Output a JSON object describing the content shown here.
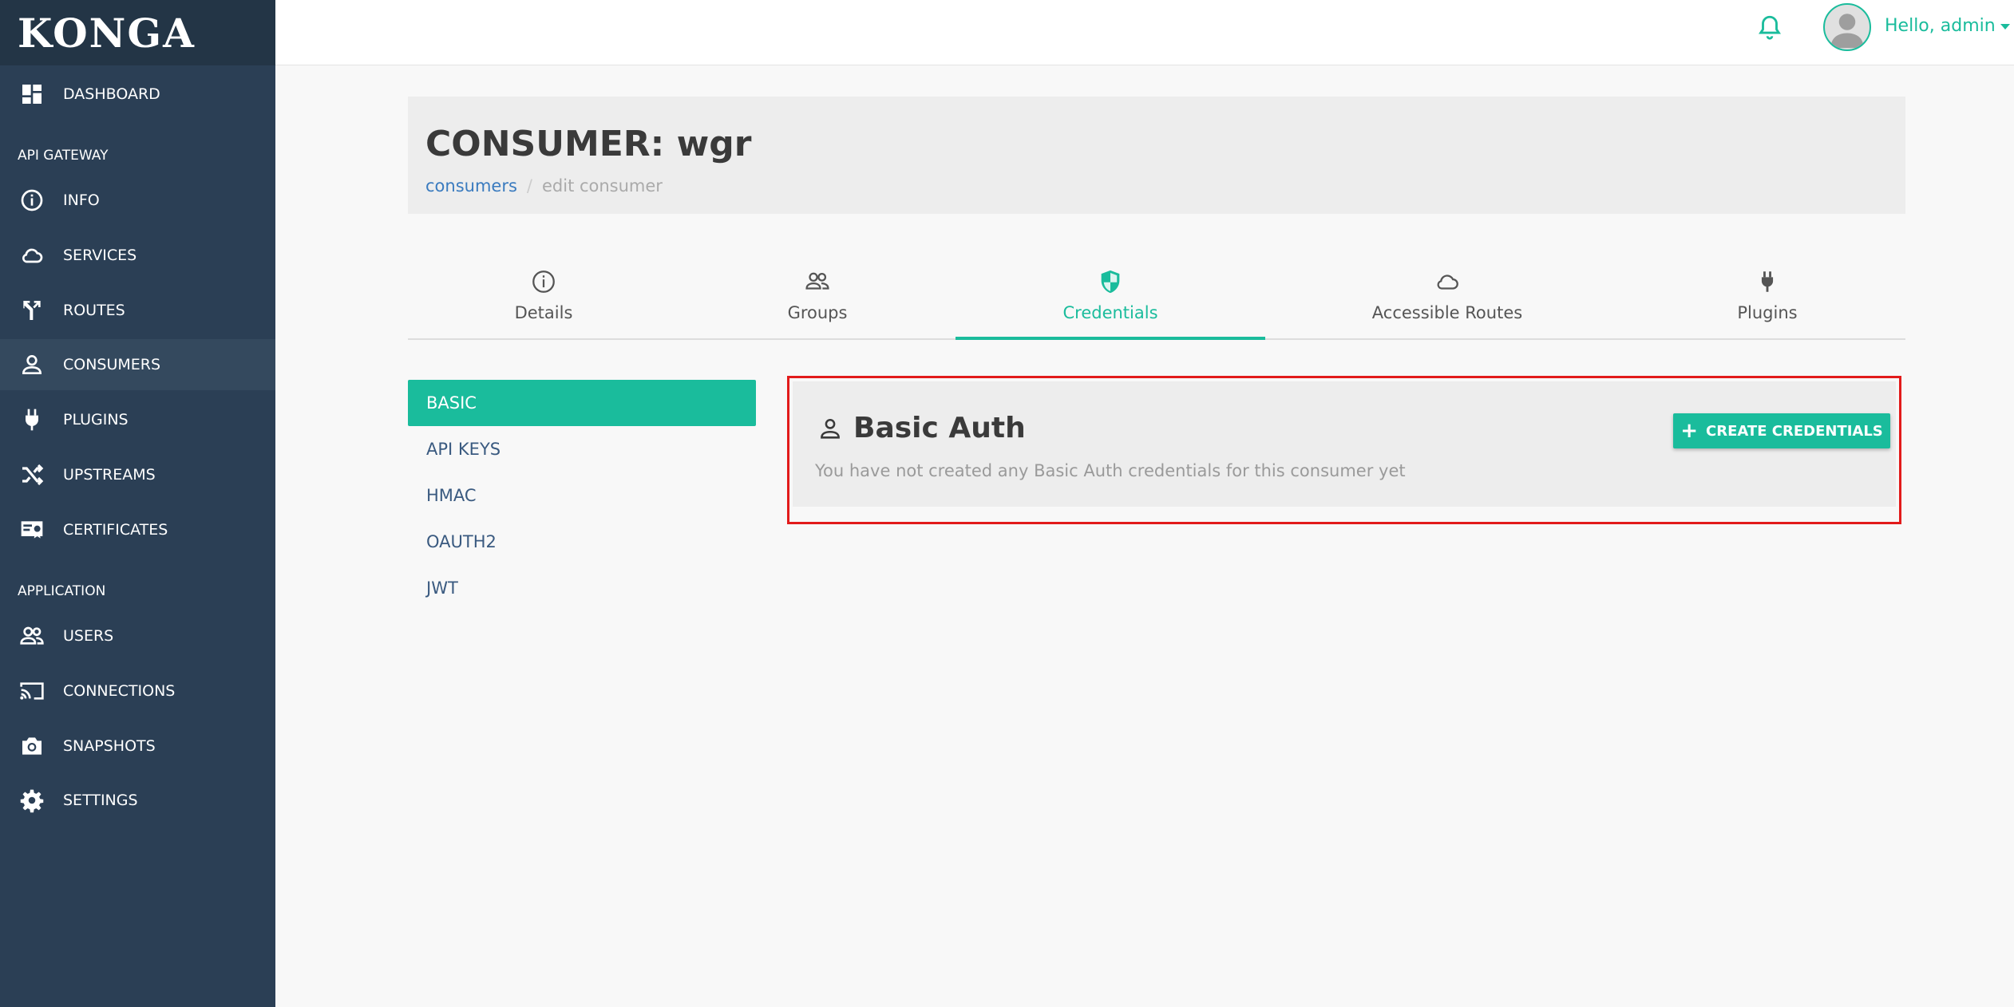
{
  "brand": {
    "name": "KONGA"
  },
  "sidebar": {
    "items": [
      {
        "label": "DASHBOARD",
        "icon": "dashboard-icon"
      },
      {
        "label": "INFO",
        "icon": "info-icon"
      },
      {
        "label": "SERVICES",
        "icon": "cloud-icon"
      },
      {
        "label": "ROUTES",
        "icon": "routes-icon"
      },
      {
        "label": "CONSUMERS",
        "icon": "person-icon",
        "active": true
      },
      {
        "label": "PLUGINS",
        "icon": "plug-icon"
      },
      {
        "label": "UPSTREAMS",
        "icon": "shuffle-icon"
      },
      {
        "label": "CERTIFICATES",
        "icon": "certificate-icon"
      },
      {
        "label": "USERS",
        "icon": "users-icon"
      },
      {
        "label": "CONNECTIONS",
        "icon": "cast-icon"
      },
      {
        "label": "SNAPSHOTS",
        "icon": "camera-icon"
      },
      {
        "label": "SETTINGS",
        "icon": "gear-icon"
      }
    ],
    "sections": {
      "api_gateway": "API GATEWAY",
      "application": "APPLICATION"
    }
  },
  "topbar": {
    "greeting": "Hello, admin"
  },
  "page": {
    "title": "CONSUMER: wgr",
    "breadcrumb": {
      "link": "consumers",
      "separator": "/",
      "current": "edit consumer"
    }
  },
  "tabs": [
    {
      "label": "Details",
      "icon": "info-icon"
    },
    {
      "label": "Groups",
      "icon": "users-icon"
    },
    {
      "label": "Credentials",
      "icon": "shield-icon",
      "active": true
    },
    {
      "label": "Accessible Routes",
      "icon": "cloud-icon"
    },
    {
      "label": "Plugins",
      "icon": "plug-icon"
    }
  ],
  "credentials_menu": [
    {
      "label": "BASIC",
      "active": true
    },
    {
      "label": "API KEYS"
    },
    {
      "label": "HMAC"
    },
    {
      "label": "OAUTH2"
    },
    {
      "label": "JWT"
    }
  ],
  "basic_auth": {
    "title": "Basic Auth",
    "empty_message": "You have not created any Basic Auth credentials for this consumer yet",
    "create_button": "CREATE CREDENTIALS"
  },
  "colors": {
    "accent": "#1abc9c",
    "sidebar": "#2b3f55",
    "highlight_border": "#e21b1b",
    "link": "#3a7bbf"
  }
}
